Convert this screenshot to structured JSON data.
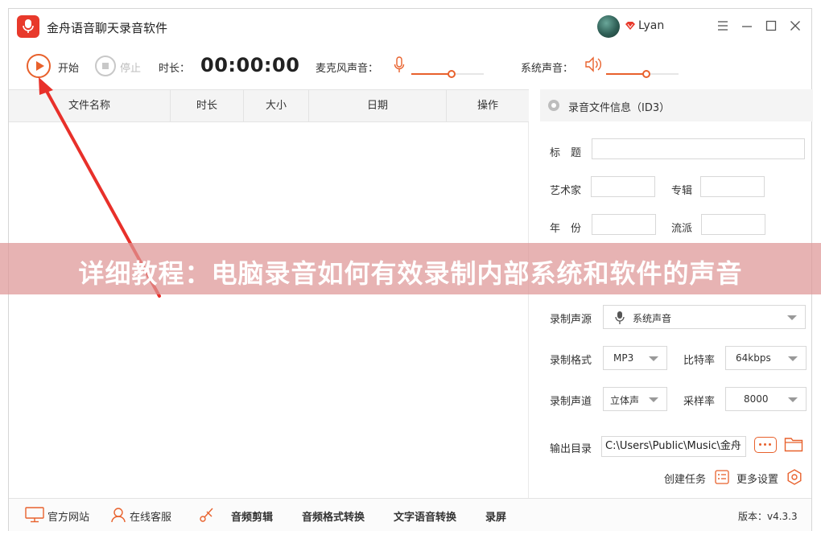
{
  "window": {
    "title": "金舟语音聊天录音软件",
    "user": "Lyan"
  },
  "toolbar": {
    "start_label": "开始",
    "stop_label": "停止",
    "duration_label": "时长：",
    "timer": "00:00:00",
    "mic_label": "麦克风声音：",
    "mic_volume": 0.55,
    "system_label": "系统声音：",
    "system_volume": 0.55
  },
  "table": {
    "columns": [
      "文件名称",
      "时长",
      "大小",
      "日期",
      "操作"
    ],
    "rows": []
  },
  "id3_panel": {
    "title": "录音文件信息（ID3）",
    "title_label": "标　题",
    "artist_label": "艺术家",
    "album_label": "专辑",
    "year_label": "年　份",
    "genre_label": "流派"
  },
  "settings": {
    "source_label": "录制声源",
    "source_value": "系统声音",
    "format_label": "录制格式",
    "format_value": "MP3",
    "bitrate_label": "比特率",
    "bitrate_value": "64kbps",
    "channel_label": "录制声道",
    "channel_value": "立体声",
    "samplerate_label": "采样率",
    "samplerate_value": "8000",
    "output_label": "输出目录",
    "output_path": "C:\\Users\\Public\\Music\\金舟",
    "create_task_label": "创建任务",
    "more_settings_label": "更多设置"
  },
  "footer": {
    "website": "官方网站",
    "support": "在线客服",
    "audio_edit": "音频剪辑",
    "format_convert": "音频格式转换",
    "tts": "文字语音转换",
    "screen_record": "录屏",
    "version": "版本：v4.3.3"
  },
  "banner": {
    "text": "详细教程：电脑录音如何有效录制内部系统和软件的声音"
  },
  "colors": {
    "accent": "#e8612c",
    "logo": "#e8392b",
    "annotation_arrow": "#e8302a"
  }
}
